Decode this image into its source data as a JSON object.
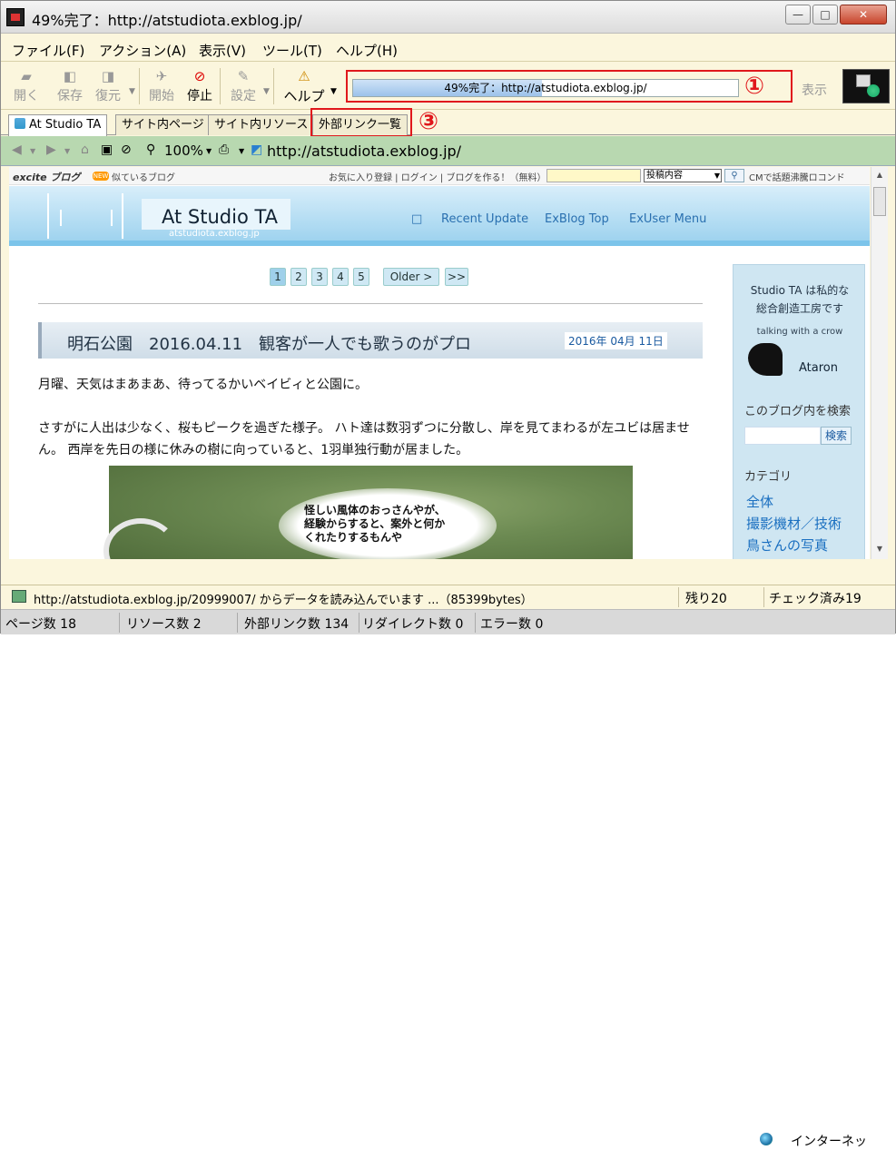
{
  "window": {
    "title": "49%完了：http://atstudiota.exblog.jp/",
    "minimize": "—",
    "maximize": "□",
    "close": "✕"
  },
  "menu": [
    "ファイル(F)",
    "アクション(A)",
    "表示(V)",
    "ツール(T)",
    "ヘルプ(H)"
  ],
  "toolbar": {
    "open": "開く",
    "save": "保存",
    "restore": "復元",
    "start": "開始",
    "stop": "停止",
    "settings": "設定",
    "help": "ヘルプ",
    "show": "表示"
  },
  "progress": {
    "text": "49%完了：http://atstudiota.exblog.jp/",
    "percent": 49,
    "annotation": "①"
  },
  "tabs": [
    "At Studio TA",
    "サイト内ページ",
    "サイト内リソース",
    "外部リンク一覧"
  ],
  "tab_annotation": "③",
  "nav": {
    "zoom": "100%",
    "address": "http://atstudiota.exblog.jp/"
  },
  "page": {
    "excite_logo": "excite ブログ",
    "new_badge": "NEW",
    "similar": "似ているブログ",
    "fav_links": "お気に入り登録 | ログイン | ブログを作る！（無料）",
    "search_select": "投稿内容",
    "pr_text": "CMで話題沸騰ロコンド【PR】",
    "blog_title": "At Studio TA",
    "blog_sub": "atstudiota.exblog.jp",
    "nav_square": "□",
    "nav_links": [
      "Recent Update",
      "ExBlog Top",
      "ExUser Menu"
    ],
    "pager": [
      "1",
      "2",
      "3",
      "4",
      "5",
      "Older >",
      ">>"
    ],
    "post_title": "明石公園　2016.04.11　観客が一人でも歌うのがプロ",
    "post_date": "2016年 04月 11日",
    "para1": "月曜、天気はまあまあ、待ってるかいベイビィと公園に。",
    "para2": "さすがに人出は少なく、桜もピークを過ぎた様子。 ハト達は数羽ずつに分散し、岸を見てまわるが左ユビは居ません。 西岸を先日の様に休みの樹に向っていると、1羽単独行動が居ました。",
    "photo_text": [
      "怪しい風体のおっさんやが、",
      "経験からすると、案外と何か",
      "くれたりするもんや"
    ]
  },
  "sidebar": {
    "tagline1": "Studio TA は私的な",
    "tagline2": "総合創造工房です",
    "talking": "talking with a crow",
    "author": "Ataron",
    "search_heading": "このブログ内を検索",
    "search_btn": "検索",
    "category_heading": "カテゴリ",
    "categories": [
      "全体",
      "撮影機材／技術",
      "鳥さんの写真"
    ]
  },
  "statusbar": {
    "zone": "インターネッ",
    "loading": "http://atstudiota.exblog.jp/20999007/ からデータを読み込んでいます ...（85399bytes）",
    "remaining": "残り20",
    "checked": "チェック済み19",
    "pages": "ページ数 18",
    "resources": "リソース数 2",
    "external": "外部リンク数 134",
    "redirects": "リダイレクト数 0",
    "errors": "エラー数 0"
  },
  "colors": {
    "annotation": "#e0181c",
    "app_bg": "#fbf6dd",
    "nav_green": "#b8d8b0",
    "blog_blue": "#9fd3ef"
  }
}
